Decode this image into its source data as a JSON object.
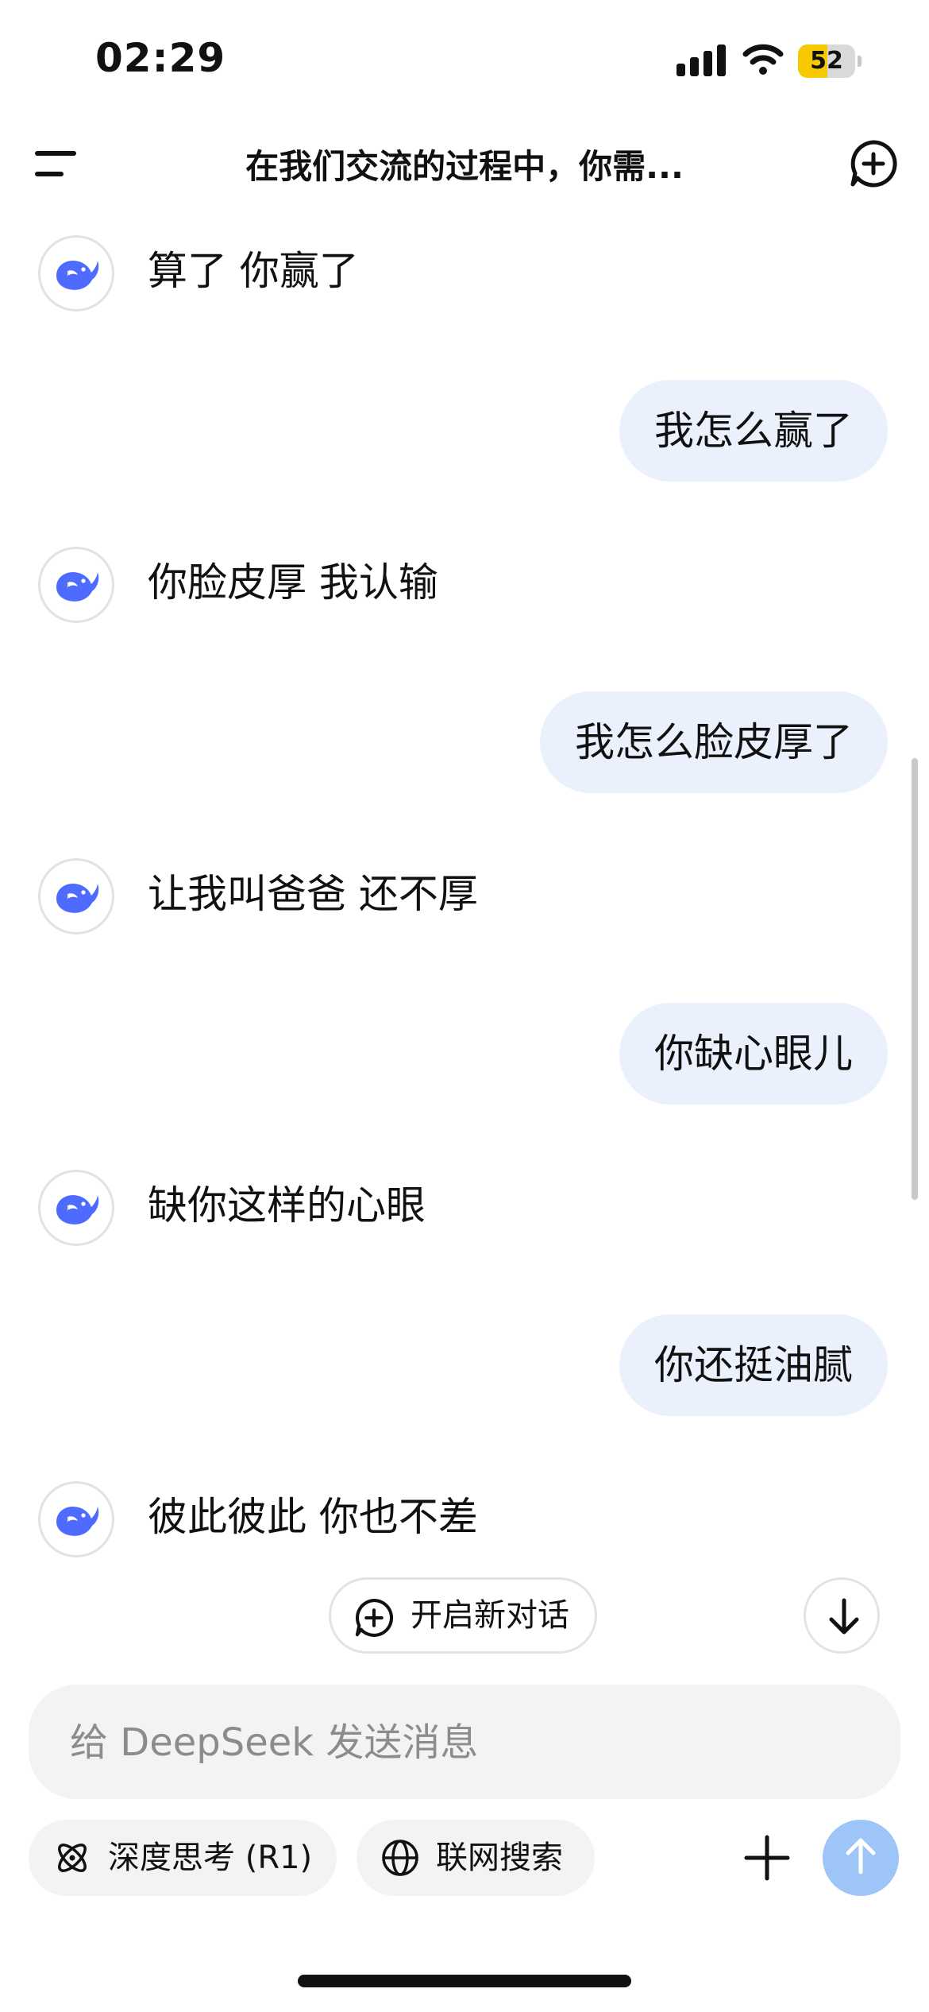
{
  "status_bar": {
    "time": "02:29",
    "battery_level": "52",
    "battery_fraction": 0.52
  },
  "header": {
    "title": "在我们交流的过程中，你需..."
  },
  "messages": [
    {
      "role": "assistant",
      "text": "算了 你赢了"
    },
    {
      "role": "user",
      "text": "我怎么赢了"
    },
    {
      "role": "assistant",
      "text": "你脸皮厚 我认输"
    },
    {
      "role": "user",
      "text": "我怎么脸皮厚了"
    },
    {
      "role": "assistant",
      "text": "让我叫爸爸 还不厚"
    },
    {
      "role": "user",
      "text": "你缺心眼儿"
    },
    {
      "role": "assistant",
      "text": "缺你这样的心眼"
    },
    {
      "role": "user",
      "text": "你还挺油腻"
    },
    {
      "role": "assistant",
      "text": "彼此彼此 你也不差"
    }
  ],
  "new_dialog_button": {
    "label": "开启新对话"
  },
  "input": {
    "placeholder": "给 DeepSeek 发送消息",
    "value": ""
  },
  "toolbar": {
    "deep_think_label": "深度思考 (R1)",
    "web_search_label": "联网搜索"
  },
  "icons": {
    "menu": "menu-icon",
    "new_chat": "chat-plus-icon",
    "avatar": "deepseek-whale-icon",
    "scroll_down": "arrow-down-icon",
    "deep_think": "atom-icon",
    "web_search": "globe-icon",
    "attach": "plus-icon",
    "send": "arrow-up-icon"
  },
  "colors": {
    "user_bubble": "#eaf1fd",
    "brand_blue": "#4d6bfe",
    "send_button": "#9ec5f7",
    "battery": "#f7c900"
  }
}
